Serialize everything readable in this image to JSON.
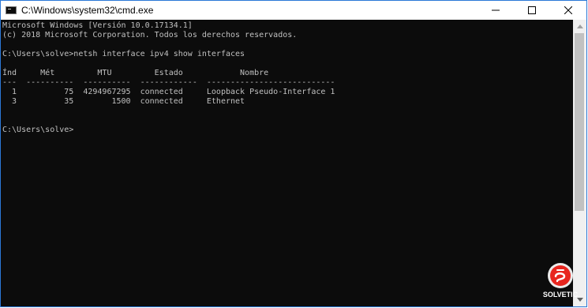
{
  "window": {
    "title": "C:\\Windows\\system32\\cmd.exe"
  },
  "controls": {
    "minimize": "minimize",
    "maximize": "maximize",
    "close": "close"
  },
  "console": {
    "lines": [
      "Microsoft Windows [Versión 10.0.17134.1]",
      "(c) 2018 Microsoft Corporation. Todos los derechos reservados.",
      "",
      "C:\\Users\\solve>netsh interface ipv4 show interfaces",
      "",
      "Índ     Mét         MTU         Estado            Nombre",
      "---  ----------  ----------  ------------  ---------------------------",
      "  1          75  4294967295  connected     Loopback Pseudo-Interface 1",
      "  3          35        1500  connected     Ethernet",
      "",
      "",
      "C:\\Users\\solve>"
    ]
  },
  "watermark": {
    "text": "SOLVETIC"
  },
  "colors": {
    "console_bg": "#0c0c0c",
    "console_text": "#c0c0c0",
    "window_border": "#2b78d7"
  }
}
